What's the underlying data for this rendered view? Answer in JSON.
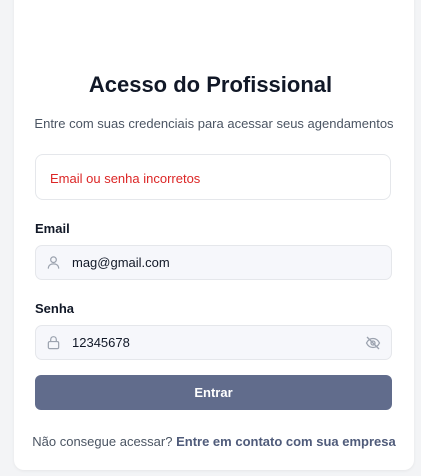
{
  "header": {
    "title": "Acesso do Profissional",
    "subtitle": "Entre com suas credenciais para acessar seus agendamentos"
  },
  "alert": {
    "message": "Email ou senha incorretos"
  },
  "form": {
    "email_label": "Email",
    "email_value": "mag@gmail.com",
    "password_label": "Senha",
    "password_value": "12345678",
    "submit_label": "Entrar"
  },
  "footer": {
    "prompt": "Não consegue acessar?",
    "link_label": "Entre em contato com sua empresa"
  },
  "icons": {
    "email": "user-icon",
    "password": "lock-icon",
    "visibility": "eye-off-icon"
  },
  "colors": {
    "error": "#dc2626",
    "button": "#616c8c",
    "link": "#4f5b7a"
  }
}
